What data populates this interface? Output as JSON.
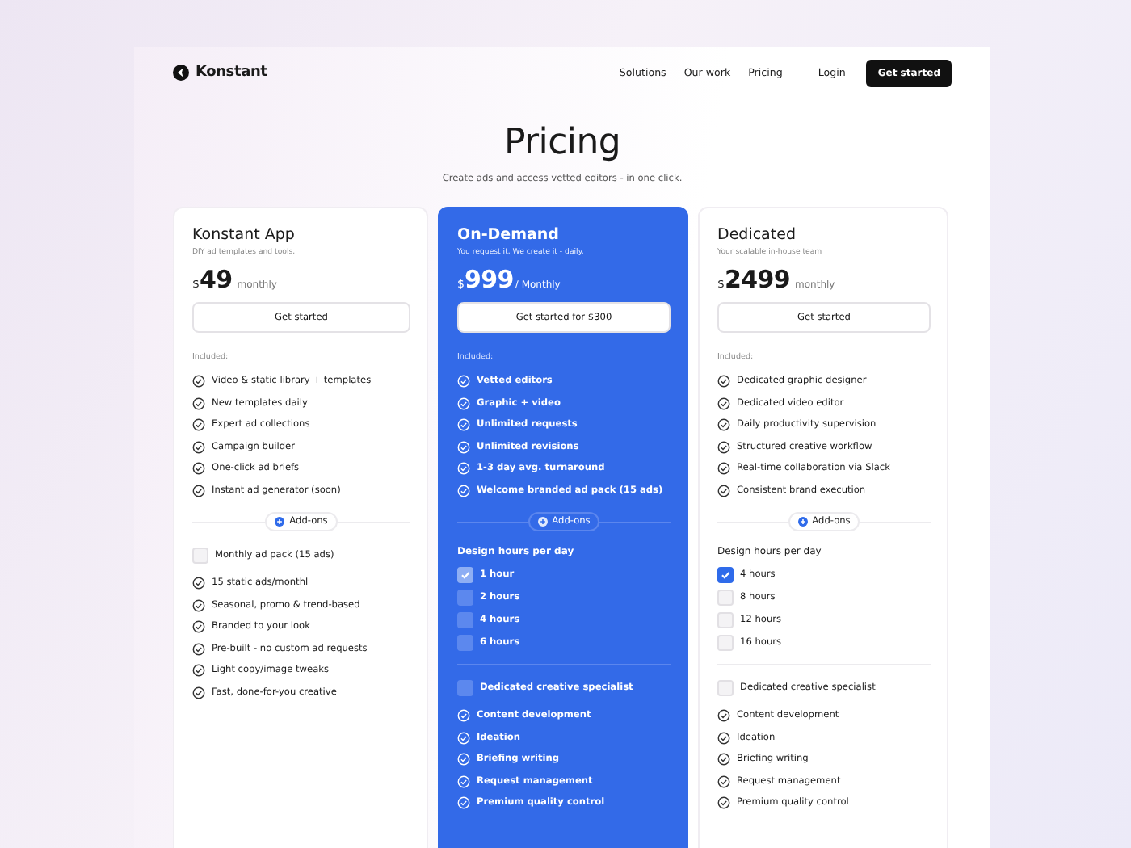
{
  "header": {
    "brand": "Konstant",
    "nav": [
      "Solutions",
      "Our work",
      "Pricing"
    ],
    "login": "Login",
    "cta": "Get started"
  },
  "hero": {
    "title": "Pricing",
    "subtitle": "Create ads and access vetted editors - in one click."
  },
  "plans": [
    {
      "name": "Konstant App",
      "tagline": "DIY ad templates and tools.",
      "currency": "$",
      "price": "49",
      "period": "monthly",
      "featured": false,
      "button": "Get started",
      "included_label": "Included:",
      "features": [
        "Video & static library + templates",
        "New templates daily",
        "Expert ad collections",
        "Campaign builder",
        "One-click ad briefs",
        "Instant ad generator (soon)"
      ],
      "addons_label": "Add-ons",
      "extra": {
        "label": "Monthly ad pack (15 ads)",
        "checked": false
      },
      "extra_features": [
        "15 static ads/monthl",
        "Seasonal, promo & trend-based",
        "Branded to your look",
        "Pre-built - no custom ad requests",
        "Light copy/image tweaks",
        "Fast, done-for-you creative"
      ]
    },
    {
      "name": "On-Demand",
      "tagline": "You request it. We create it - daily.",
      "currency": "$",
      "price": "999",
      "period": "/ Monthly",
      "featured": true,
      "button": "Get started for $300",
      "included_label": "Included:",
      "features": [
        "Vetted editors",
        "Graphic + video",
        "Unlimited requests",
        "Unlimited revisions",
        "1-3 day avg. turnaround",
        "Welcome branded ad pack (15 ads)"
      ],
      "addons_label": "Add-ons",
      "hours": {
        "label": "Design hours per day",
        "options": [
          {
            "label": "1 hour",
            "checked": true
          },
          {
            "label": "2 hours",
            "checked": false
          },
          {
            "label": "4 hours",
            "checked": false
          },
          {
            "label": "6 hours",
            "checked": false
          }
        ]
      },
      "extra": {
        "label": "Dedicated creative specialist",
        "checked": false
      },
      "extra_features": [
        "Content development",
        "Ideation",
        "Briefing writing",
        "Request management",
        "Premium quality control"
      ]
    },
    {
      "name": "Dedicated",
      "tagline": "Your scalable in-house team",
      "currency": "$",
      "price": "2499",
      "period": "monthly",
      "featured": false,
      "button": "Get started",
      "included_label": "Included:",
      "features": [
        "Dedicated graphic designer",
        "Dedicated video editor",
        "Daily productivity supervision",
        "Structured creative workflow",
        "Real-time collaboration via Slack",
        "Consistent brand execution"
      ],
      "addons_label": "Add-ons",
      "hours": {
        "label": "Design hours per day",
        "options": [
          {
            "label": "4 hours",
            "checked": true
          },
          {
            "label": "8 hours",
            "checked": false
          },
          {
            "label": "12 hours",
            "checked": false
          },
          {
            "label": "16 hours",
            "checked": false
          }
        ]
      },
      "extra": {
        "label": "Dedicated creative specialist",
        "checked": false
      },
      "extra_features": [
        "Content development",
        "Ideation",
        "Briefing writing",
        "Request management",
        "Premium quality control"
      ]
    }
  ]
}
